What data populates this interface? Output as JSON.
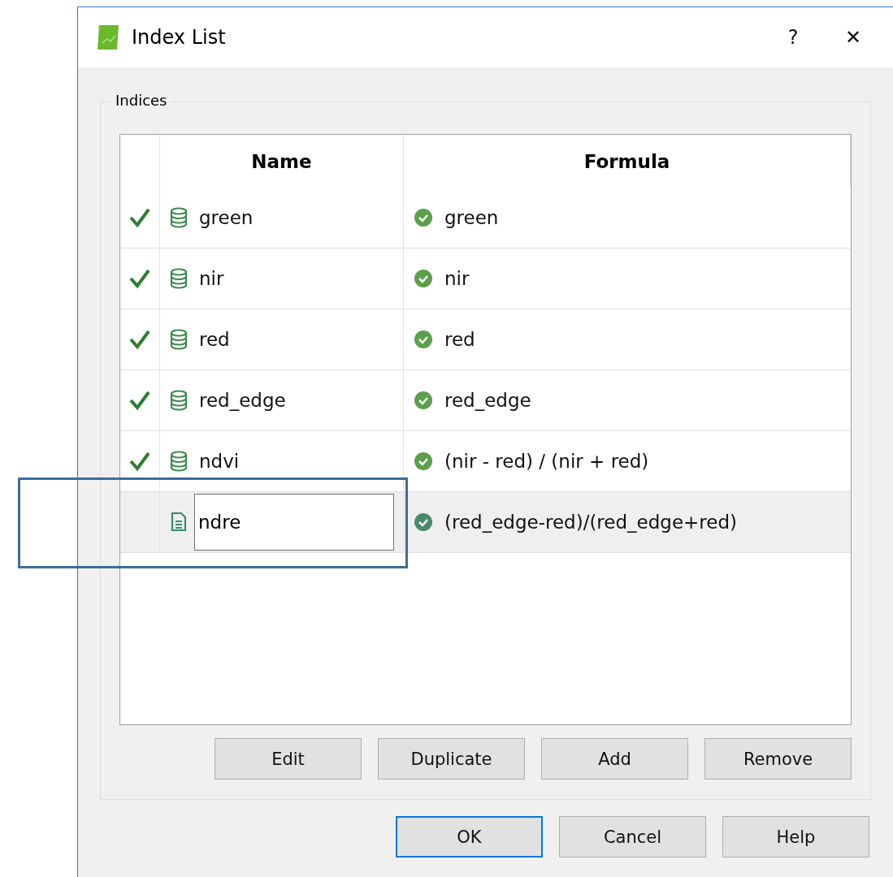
{
  "window": {
    "title": "Index List",
    "buttons": [
      "?",
      "✕"
    ]
  },
  "group": {
    "title": "Indices"
  },
  "table": {
    "columns": [
      "Name",
      "Formula"
    ],
    "rows": [
      {
        "name": "green",
        "formula": "green",
        "checked": true,
        "kind": "band",
        "selected": false,
        "editing": false
      },
      {
        "name": "nir",
        "formula": "nir",
        "checked": true,
        "kind": "band",
        "selected": false,
        "editing": false
      },
      {
        "name": "red",
        "formula": "red",
        "checked": true,
        "kind": "band",
        "selected": false,
        "editing": false
      },
      {
        "name": "red_edge",
        "formula": "red_edge",
        "checked": true,
        "kind": "band",
        "selected": false,
        "editing": false
      },
      {
        "name": "ndvi",
        "formula": "(nir - red) / (nir + red)",
        "checked": true,
        "kind": "band",
        "selected": false,
        "editing": false
      },
      {
        "name": "ndre",
        "formula": "(red_edge-red)/(red_edge+red)",
        "checked": false,
        "kind": "document",
        "selected": true,
        "editing": true
      }
    ]
  },
  "list_buttons": [
    "Edit",
    "Duplicate",
    "Add",
    "Remove"
  ],
  "dialog_buttons": [
    {
      "label": "OK",
      "default": true
    },
    {
      "label": "Cancel",
      "default": false
    },
    {
      "label": "Help",
      "default": false
    }
  ],
  "highlight": {
    "shown": true
  }
}
